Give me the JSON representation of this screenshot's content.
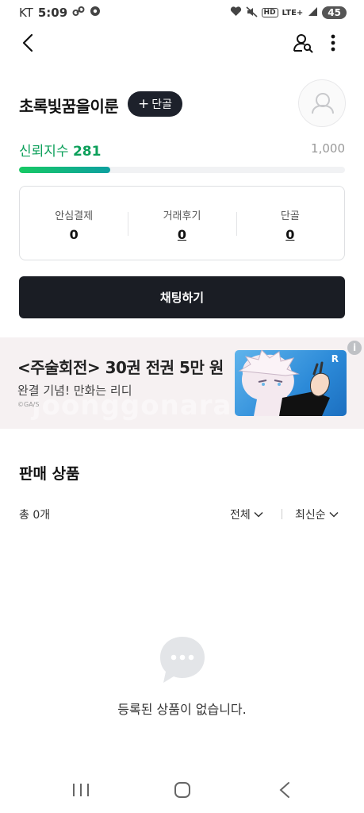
{
  "status_bar": {
    "carrier": "KT",
    "time": "5:09",
    "network": "LTE+",
    "hd": "HD",
    "battery": "45",
    "icons": [
      "link-icon",
      "location-icon",
      "heart-icon",
      "mute-icon",
      "hd-icon",
      "lte-icon",
      "signal-icon",
      "battery-icon"
    ]
  },
  "header": {
    "icons": [
      "back-icon",
      "user-search-icon",
      "more-vertical-icon"
    ]
  },
  "profile": {
    "nickname": "초록빛꿈을이룬",
    "follow_label": "단골",
    "follow_prefix": "+",
    "trust_label": "신뢰지수",
    "trust_value": "281",
    "trust_max": "1,000",
    "trust_progress": 0.281,
    "accent_color": "#0da05b",
    "stats": [
      {
        "label": "안심결제",
        "value": "0"
      },
      {
        "label": "거래후기",
        "value": "0"
      },
      {
        "label": "단골",
        "value": "0"
      }
    ],
    "chat_button": "채팅하기"
  },
  "banner": {
    "title": "<주술회전> 30권 전권 5만 원",
    "subtitle": "완결 기념! 만화는 리디",
    "copyright": "©GA/S",
    "watermark": "joonggonara",
    "info_icon": "i",
    "image_badge": "R"
  },
  "products": {
    "section_title": "판매 상품",
    "count": "총 0개",
    "filter_all": "전체",
    "filter_sort": "최신순",
    "empty_message": "등록된 상품이 없습니다."
  },
  "nav": {
    "icons": [
      "recent-apps-icon",
      "home-icon",
      "back-nav-icon"
    ]
  }
}
